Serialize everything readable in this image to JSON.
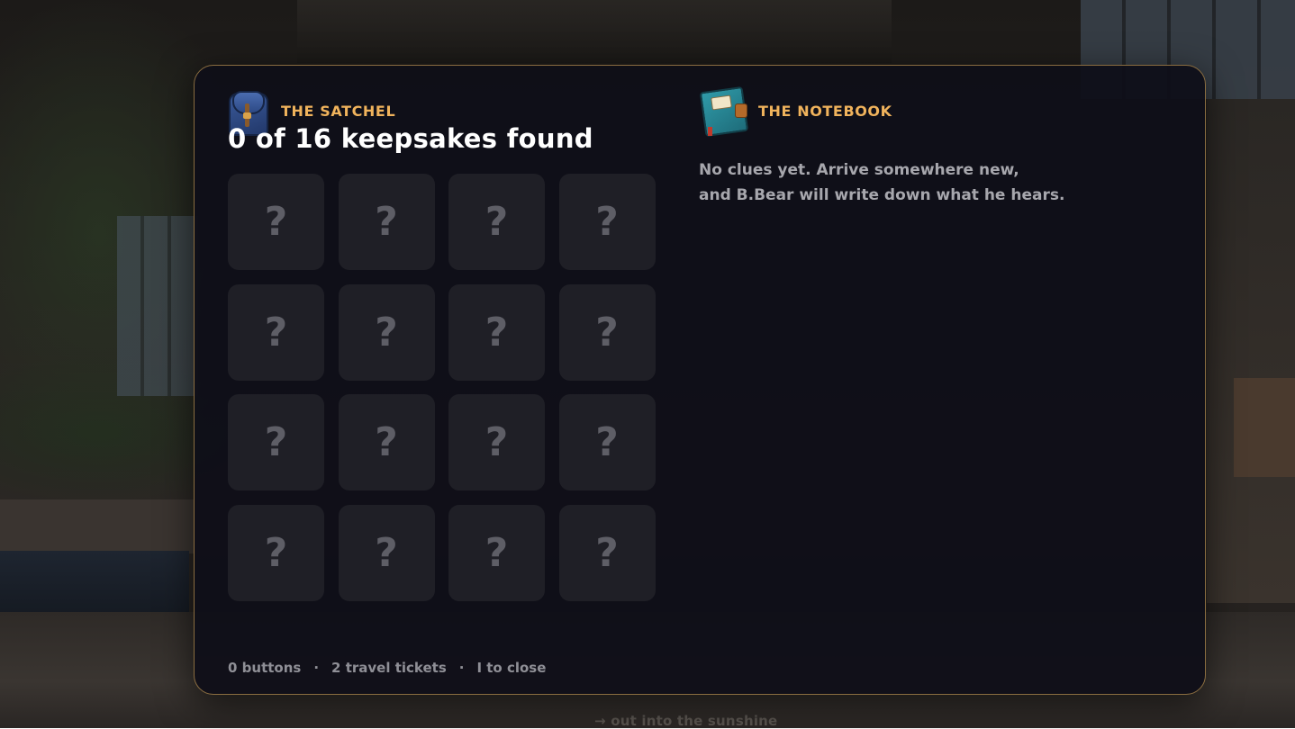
{
  "satchel": {
    "label": "THE SATCHEL",
    "icon": "satchel-icon",
    "found_title": "0 of 16 keepsakes found",
    "slots": [
      "?",
      "?",
      "?",
      "?",
      "?",
      "?",
      "?",
      "?",
      "?",
      "?",
      "?",
      "?",
      "?",
      "?",
      "?",
      "?"
    ]
  },
  "notebook": {
    "label": "THE NOTEBOOK",
    "icon": "notebook-icon",
    "line1": "No clues yet. Arrive somewhere new,",
    "line2": "and B.Bear will write down what he hears."
  },
  "footer": {
    "buttons": "0 buttons",
    "separator": "·",
    "tickets": "2 travel tickets",
    "close_hint": "I to close"
  },
  "background": {
    "exit_hint": "→ out into the sunshine"
  },
  "colors": {
    "accent": "#f0b35c",
    "panel_border": "#8a6d40",
    "panel_bg": "#0e0e18",
    "slot_bg": "#1f1f26",
    "slot_mark": "#5e5e66",
    "text_muted": "#a7a7ad"
  }
}
